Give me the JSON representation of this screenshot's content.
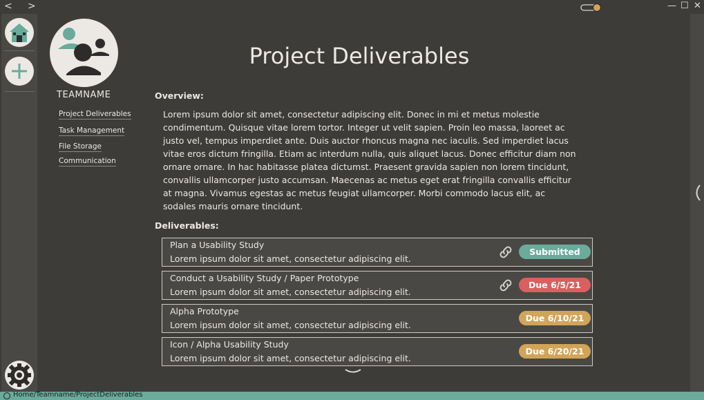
{
  "nav": {
    "back": "<",
    "forward": ">"
  },
  "window_controls": {
    "minimize": "—",
    "maximize": "☐",
    "close": "✕"
  },
  "team": {
    "name": "TEAMNAME",
    "links": [
      "Project Deliverables",
      "Task Management",
      "File Storage",
      "Communication"
    ]
  },
  "page": {
    "title": "Project Deliverables",
    "overview_heading": "Overview:",
    "overview_text": "Lorem ipsum dolor sit amet, consectetur adipiscing elit. Donec in mi et metus molestie condimentum. Quisque vitae lorem tortor. Integer ut velit sapien. Proin leo massa, laoreet ac justo vel, tempus imperdiet ante. Duis auctor rhoncus magna nec iaculis. Sed imperdiet lacus vitae eros dictum fringilla. Etiam ac interdum nulla, quis aliquet lacus. Donec efficitur diam non ornare ornare. In hac habitasse platea dictumst. Praesent gravida sapien non lorem tincidunt, convallis ullamcorper justo accumsan. Maecenas ac metus eget erat fringilla convallis efficitur at magna. Vivamus egestas ac metus feugiat ullamcorper. Morbi commodo lacus elit, ac sodales mauris ornare tincidunt.",
    "deliverables_heading": "Deliverables:"
  },
  "deliverables": [
    {
      "title": "Plan a Usability Study",
      "desc": "Lorem ipsum dolor sit amet, consectetur adipiscing elit.",
      "status": "Submitted",
      "color": "#6aab9b",
      "has_link": true
    },
    {
      "title": "Conduct a Usability Study / Paper Prototype",
      "desc": "Lorem ipsum dolor sit amet, consectetur adipiscing elit.",
      "status": "Due 6/5/21",
      "color": "#d9605f",
      "has_link": true
    },
    {
      "title": "Alpha Prototype",
      "desc": "Lorem ipsum dolor sit amet, consectetur adipiscing elit.",
      "status": "Due 6/10/21",
      "color": "#d1a458",
      "has_link": false
    },
    {
      "title": "Icon / Alpha Usability Study",
      "desc": "Lorem ipsum dolor sit amet, consectetur adipiscing elit.",
      "status": "Due 6/20/21",
      "color": "#d1a458",
      "has_link": false
    }
  ],
  "statusbar": {
    "path": "Home/Teamname/ProjectDeliverables"
  },
  "icons": {
    "home": "home-icon",
    "add": "plus-icon",
    "settings": "gear-icon",
    "link": "link-icon",
    "theme": "theme-toggle-icon",
    "collapse": "chevron-left-icon",
    "scroll": "chevron-down-icon"
  }
}
